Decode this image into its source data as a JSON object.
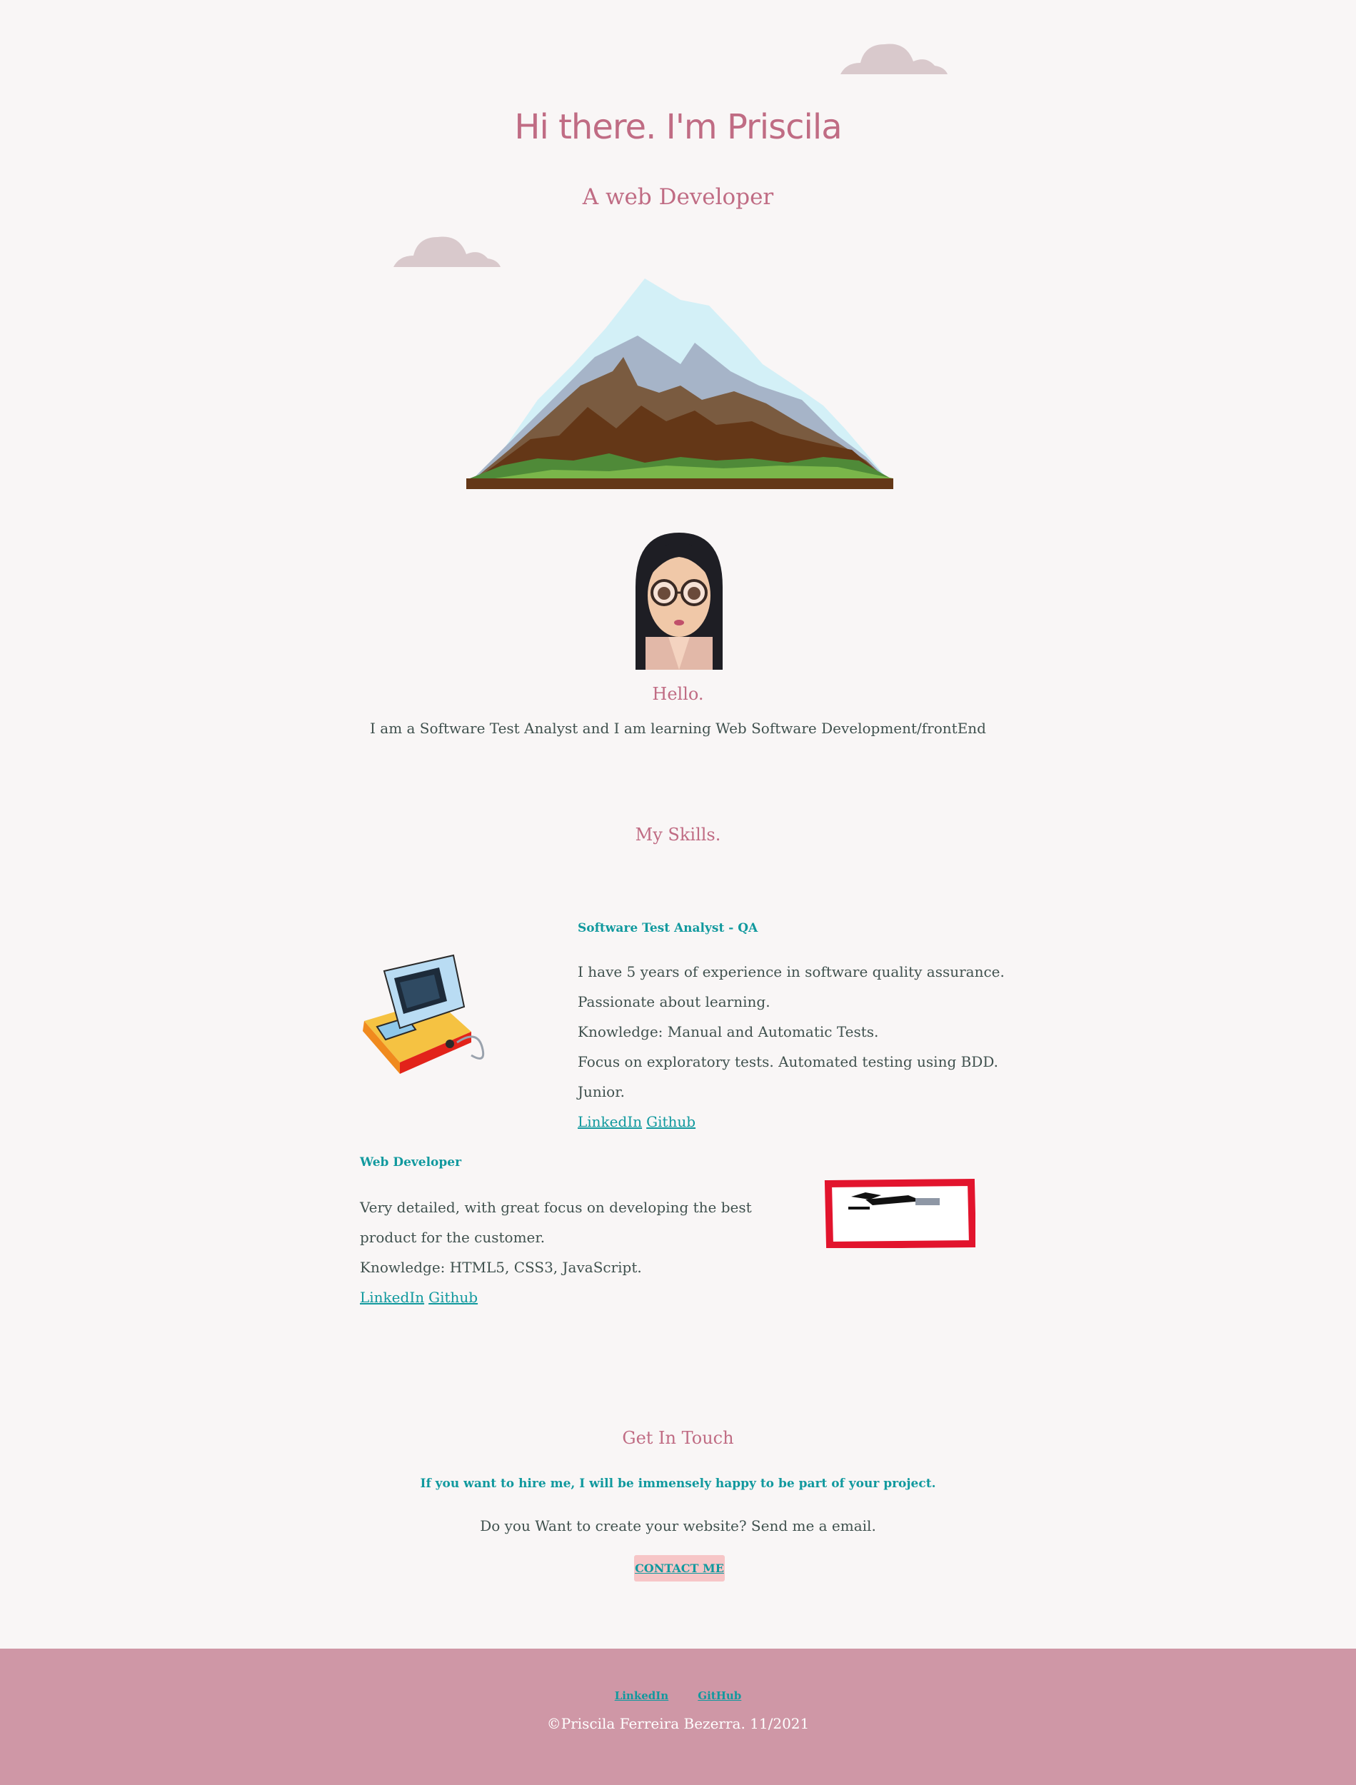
{
  "header": {
    "title": "Hi there. I'm Priscila",
    "subtitle": "A web Developer"
  },
  "profile": {
    "greeting": "Hello.",
    "intro": "I am a Software Test Analyst and I am learning Web Software Development/frontEnd"
  },
  "skills": {
    "title": "My Skills.",
    "items": [
      {
        "title": "Software Test Analyst - QA",
        "lines": [
          "I have 5 years of experience in software quality assurance. Passionate about learning.",
          "Knowledge: Manual and Automatic Tests.",
          "Focus on exploratory tests. Automated testing using BDD. Junior."
        ],
        "links": [
          "LinkedIn",
          "Github"
        ]
      },
      {
        "title": "Web Developer",
        "lines": [
          "Very detailed, with great focus on developing the best product for the customer.",
          "Knowledge: HTML5, CSS3, JavaScript."
        ],
        "links": [
          "LinkedIn",
          "Github"
        ]
      }
    ]
  },
  "contact": {
    "title": "Get In Touch",
    "tagline": "If you want to hire me, I will be immensely happy to be part of your project.",
    "text": "Do you Want to create your website? Send me a email.",
    "button": "CONTACT ME"
  },
  "footer": {
    "links": [
      "LinkedIn",
      "GitHub"
    ],
    "copyright": "©Priscila Ferreira Bezerra. 11/2021"
  },
  "colors": {
    "background": "#f9f6f6",
    "heading": "#c06c84",
    "accent": "#11999e",
    "footer": "#cf97a6",
    "button": "#f7c6c7"
  }
}
